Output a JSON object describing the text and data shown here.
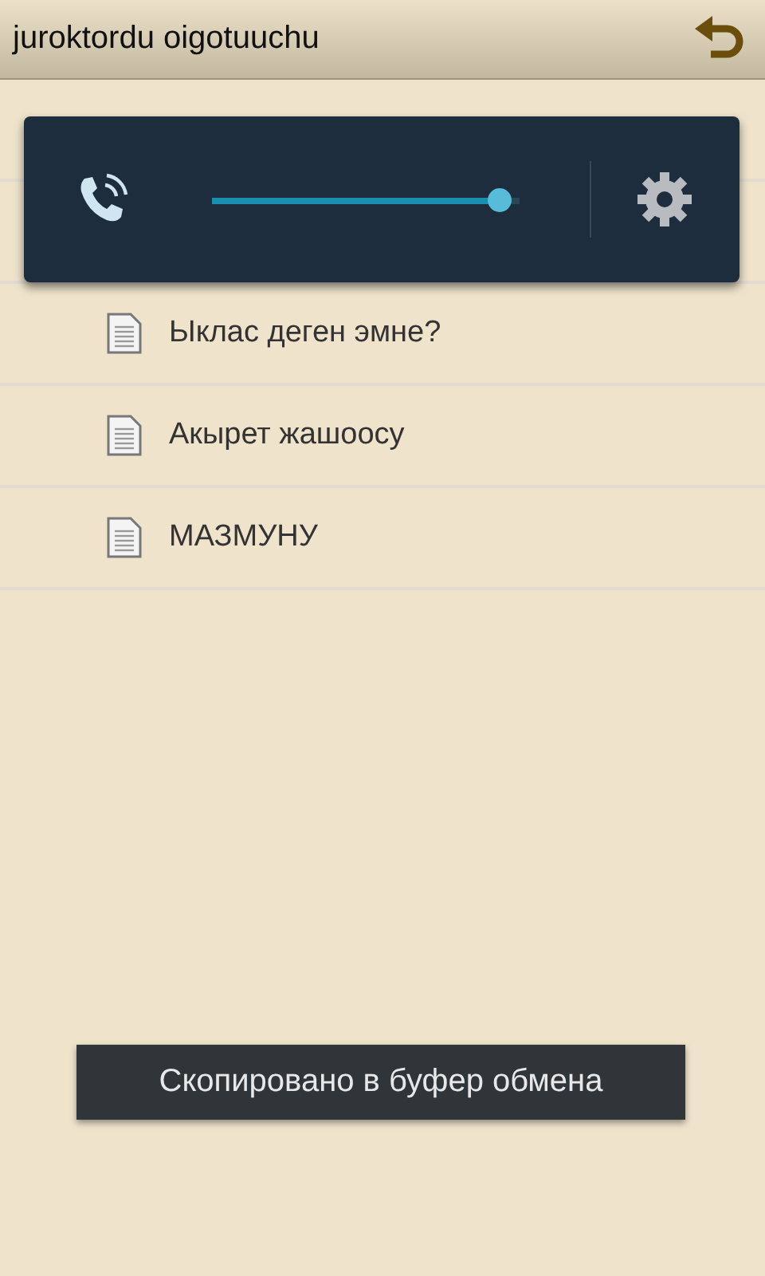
{
  "header": {
    "title": "juroktordu oigotuuchu"
  },
  "items": [
    {
      "label": "Ыклас деген эмне?"
    },
    {
      "label": "Акырет жашоосу"
    },
    {
      "label": "МАЗМУНУ"
    }
  ],
  "volume_panel": {
    "level": 0.97
  },
  "toast": {
    "text": "Скопировано в буфер обмена"
  }
}
